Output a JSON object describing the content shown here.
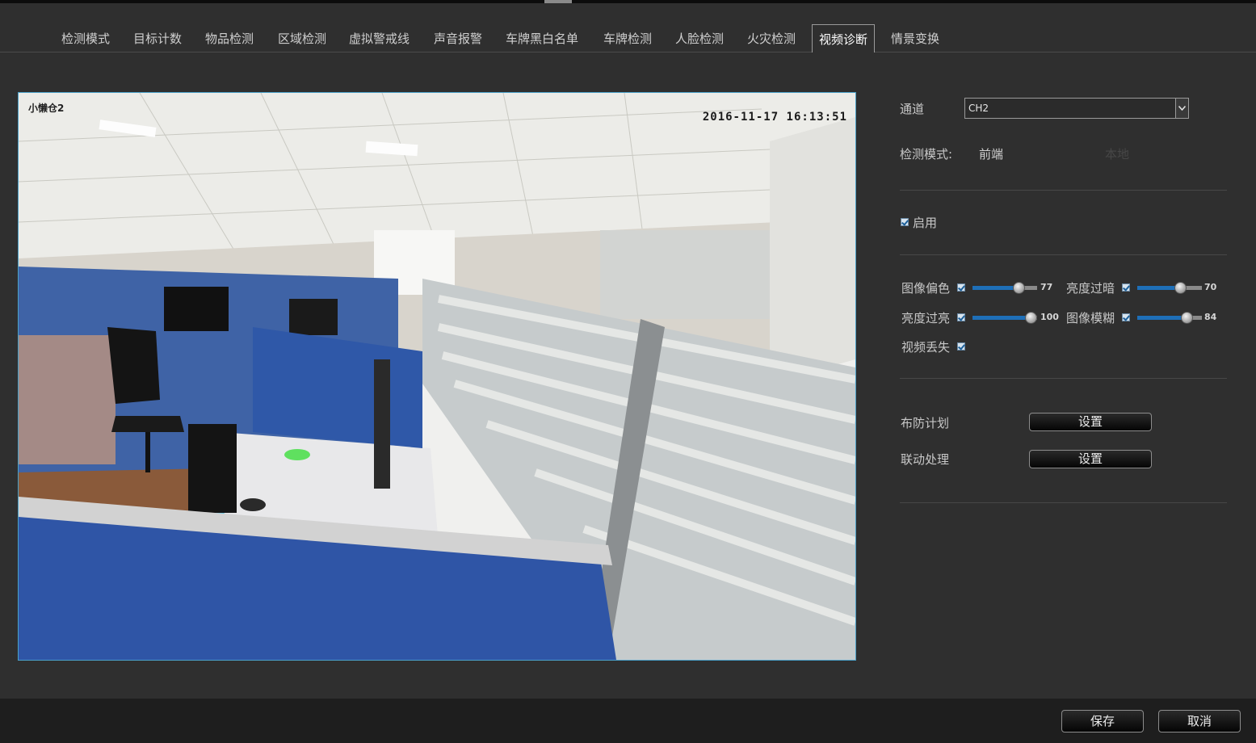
{
  "tabs": [
    {
      "label": "检测模式",
      "active": false
    },
    {
      "label": "目标计数",
      "active": false
    },
    {
      "label": "物品检测",
      "active": false
    },
    {
      "label": "区域检测",
      "active": false
    },
    {
      "label": "虚拟警戒线",
      "active": false
    },
    {
      "label": "声音报警",
      "active": false
    },
    {
      "label": "车牌黑白名单",
      "active": false
    },
    {
      "label": "车牌检测",
      "active": false
    },
    {
      "label": "人脸检测",
      "active": false
    },
    {
      "label": "火灾检测",
      "active": false
    },
    {
      "label": "视频诊断",
      "active": true
    },
    {
      "label": "情景变换",
      "active": false
    }
  ],
  "video": {
    "osd_name": "小懒仓2",
    "osd_time": "2016-11-17 16:13:51"
  },
  "settings": {
    "channel_label": "通道",
    "channel_value": "CH2",
    "mode_label": "检测模式:",
    "mode_front": "前端",
    "mode_local": "本地",
    "enable_label": "启用",
    "enable_checked": true
  },
  "diagnostics": [
    {
      "label": "图像偏色",
      "checked": true,
      "value": 77,
      "show_value": "77"
    },
    {
      "label": "亮度过暗",
      "checked": true,
      "value": 70,
      "show_value": "70"
    },
    {
      "label": "亮度过亮",
      "checked": true,
      "value": 100,
      "show_value": "100"
    },
    {
      "label": "图像模糊",
      "checked": true,
      "value": 84,
      "show_value": "84"
    },
    {
      "label": "视频丢失",
      "checked": true
    }
  ],
  "schedule": {
    "label": "布防计划",
    "button": "设置"
  },
  "linkage": {
    "label": "联动处理",
    "button": "设置"
  },
  "footer": {
    "save": "保存",
    "cancel": "取消"
  },
  "colors": {
    "accent": "#1e6fb8",
    "background": "#2f2f2f",
    "footer": "#1e1e1e"
  }
}
